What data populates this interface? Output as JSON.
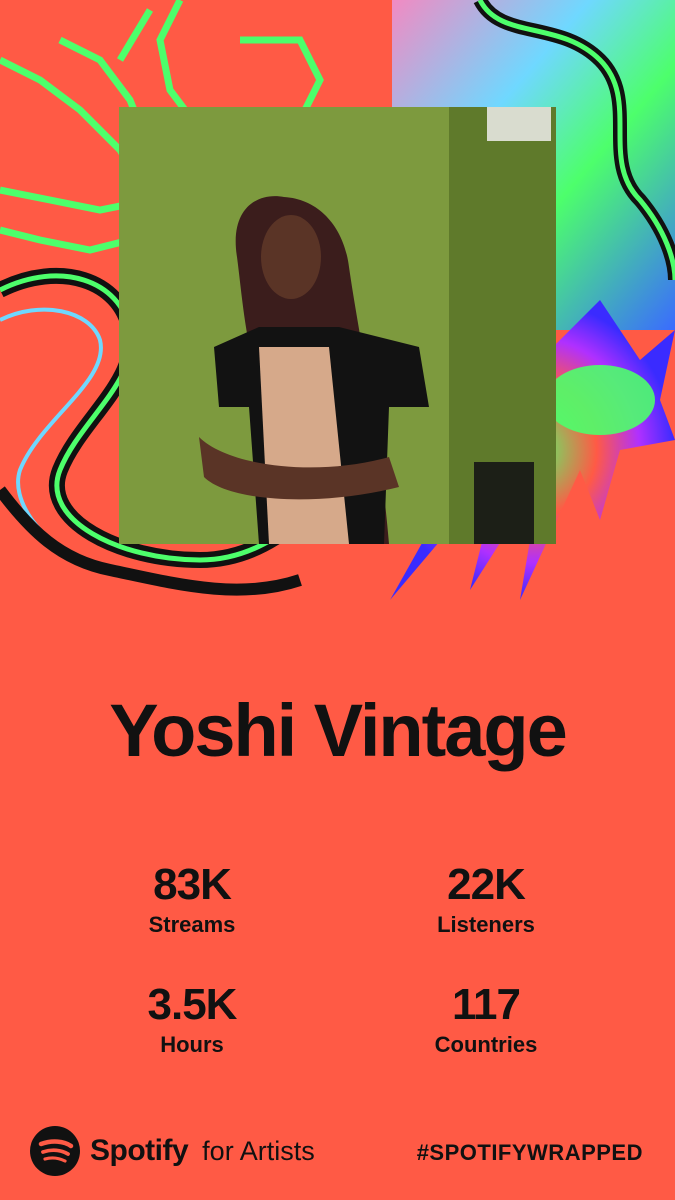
{
  "artist": {
    "name": "Yoshi Vintage"
  },
  "stats": [
    {
      "value": "83K",
      "label": "Streams"
    },
    {
      "value": "22K",
      "label": "Listeners"
    },
    {
      "value": "3.5K",
      "label": "Hours"
    },
    {
      "value": "117",
      "label": "Countries"
    }
  ],
  "footer": {
    "brand": "Spotify",
    "brand_suffix": "for Artists",
    "hashtag": "#SPOTIFYWRAPPED"
  },
  "colors": {
    "background": "#ff5a45",
    "accent_green": "#4dff6b",
    "text": "#111111"
  },
  "icons": [
    "spotify-logo-icon"
  ]
}
